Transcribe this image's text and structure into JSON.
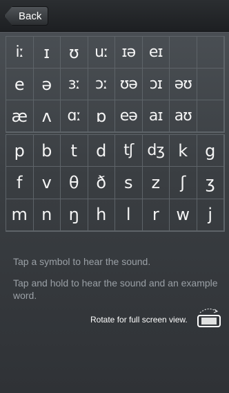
{
  "nav": {
    "back_label": "Back"
  },
  "vowels": [
    "iː",
    "ɪ",
    "ʊ",
    "uː",
    "ɪə",
    "eɪ",
    "",
    "",
    "e",
    "ə",
    "ɜː",
    "ɔː",
    "ʊə",
    "ɔɪ",
    "əʊ",
    "",
    "æ",
    "ʌ",
    "ɑː",
    "ɒ",
    "eə",
    "aɪ",
    "aʊ",
    ""
  ],
  "consonants": [
    "p",
    "b",
    "t",
    "d",
    "tʃ",
    "dʒ",
    "k",
    "g",
    "f",
    "v",
    "θ",
    "ð",
    "s",
    "z",
    "ʃ",
    "ʒ",
    "m",
    "n",
    "ŋ",
    "h",
    "l",
    "r",
    "w",
    "j"
  ],
  "instructions": {
    "line1": "Tap a symbol to hear the sound.",
    "line2": "Tap and hold to hear the sound and an example word."
  },
  "rotate_hint": "Rotate for full screen view.",
  "icons": {
    "back": "back-arrow-icon",
    "rotate": "rotate-device-icon"
  }
}
